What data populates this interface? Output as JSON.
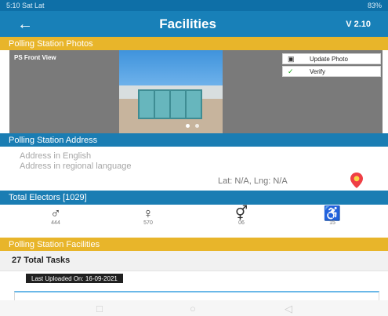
{
  "status": {
    "time": "5:10",
    "carrier": "Sat Lat",
    "right": "83%"
  },
  "header": {
    "back_icon": "arrow-left-icon",
    "title": "Facilities",
    "version": "V 2.10"
  },
  "sections": {
    "photos": "Polling Station Photos",
    "address": "Polling Station Address",
    "electors": "Total Electors [1029]",
    "facilities": "Polling Station Facilities"
  },
  "photo": {
    "label": "PS Front View",
    "update_label": "Update Photo",
    "verify_label": "Verify",
    "update_icon": "camera-icon",
    "verify_icon": "check-icon"
  },
  "address": {
    "english_placeholder": "Address in English",
    "regional_placeholder": "Address in regional language",
    "coordinates": "Lat: N/A, Lng: N/A",
    "location_icon": "location-pin-icon"
  },
  "electors": [
    {
      "icon": "male-icon",
      "value": "444"
    },
    {
      "icon": "female-icon",
      "value": "570"
    },
    {
      "icon": "third-gender-icon",
      "value": "06"
    },
    {
      "icon": "wheelchair-icon",
      "value": "15"
    }
  ],
  "tasks": {
    "total": "27 Total Tasks",
    "uploaded": "Last Uploaded On: 16-09-2021"
  },
  "nav": {
    "recent_icon": "recent-apps-icon",
    "home_icon": "home-icon",
    "back_icon": "back-icon"
  },
  "colors": {
    "status_bar": "#0e6fa7",
    "app_bar": "#1880b8",
    "accent_yellow": "#e8b52a"
  }
}
